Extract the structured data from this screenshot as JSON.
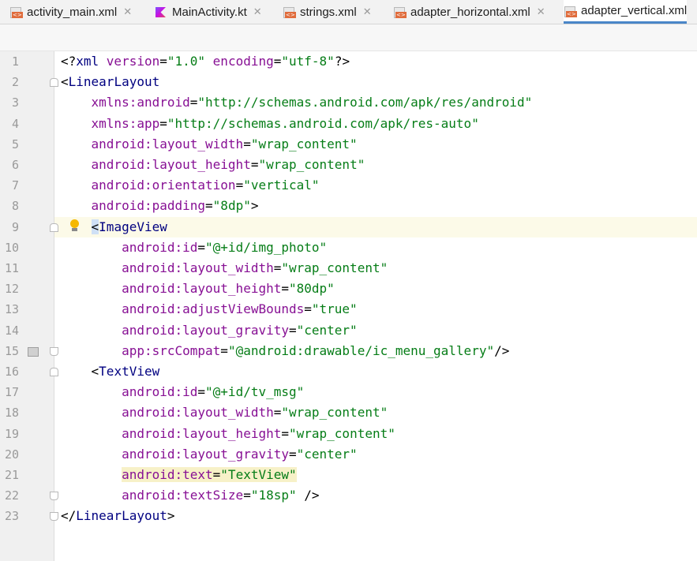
{
  "tabs": [
    {
      "label": "activity_main.xml",
      "icon": "xml-file-icon",
      "close": "✕",
      "active": false
    },
    {
      "label": "MainActivity.kt",
      "icon": "kotlin-file-icon",
      "close": "✕",
      "active": false
    },
    {
      "label": "strings.xml",
      "icon": "xml-file-icon",
      "close": "✕",
      "active": false
    },
    {
      "label": "adapter_horizontal.xml",
      "icon": "xml-file-icon",
      "close": "✕",
      "active": false
    },
    {
      "label": "adapter_vertical.xml",
      "icon": "xml-file-icon",
      "close": "",
      "active": true
    }
  ],
  "editor": {
    "line_numbers": [
      "1",
      "2",
      "3",
      "4",
      "5",
      "6",
      "7",
      "8",
      "9",
      "10",
      "11",
      "12",
      "13",
      "14",
      "15",
      "16",
      "17",
      "18",
      "19",
      "20",
      "21",
      "22",
      "23"
    ],
    "lines": [
      [
        {
          "t": "pun",
          "v": "<?"
        },
        {
          "t": "tag",
          "v": "xml "
        },
        {
          "t": "attr",
          "v": "version"
        },
        {
          "t": "pun",
          "v": "="
        },
        {
          "t": "val",
          "v": "\"1.0\" "
        },
        {
          "t": "attr",
          "v": "encoding"
        },
        {
          "t": "pun",
          "v": "="
        },
        {
          "t": "val",
          "v": "\"utf-8\""
        },
        {
          "t": "pun",
          "v": "?>"
        }
      ],
      [
        {
          "t": "pun",
          "v": "<"
        },
        {
          "t": "tag",
          "v": "LinearLayout"
        }
      ],
      [
        {
          "t": "plain",
          "v": "    "
        },
        {
          "t": "attr",
          "v": "xmlns:android"
        },
        {
          "t": "pun",
          "v": "="
        },
        {
          "t": "val",
          "v": "\"http://schemas.android.com/apk/res/android\""
        }
      ],
      [
        {
          "t": "plain",
          "v": "    "
        },
        {
          "t": "attr",
          "v": "xmlns:app"
        },
        {
          "t": "pun",
          "v": "="
        },
        {
          "t": "val",
          "v": "\"http://schemas.android.com/apk/res-auto\""
        }
      ],
      [
        {
          "t": "plain",
          "v": "    "
        },
        {
          "t": "attr",
          "v": "android:layout_width"
        },
        {
          "t": "pun",
          "v": "="
        },
        {
          "t": "val",
          "v": "\"wrap_content\""
        }
      ],
      [
        {
          "t": "plain",
          "v": "    "
        },
        {
          "t": "attr",
          "v": "android:layout_height"
        },
        {
          "t": "pun",
          "v": "="
        },
        {
          "t": "val",
          "v": "\"wrap_content\""
        }
      ],
      [
        {
          "t": "plain",
          "v": "    "
        },
        {
          "t": "attr",
          "v": "android:orientation"
        },
        {
          "t": "pun",
          "v": "="
        },
        {
          "t": "val",
          "v": "\"vertical\""
        }
      ],
      [
        {
          "t": "plain",
          "v": "    "
        },
        {
          "t": "attr",
          "v": "android:padding"
        },
        {
          "t": "pun",
          "v": "="
        },
        {
          "t": "val",
          "v": "\"8dp\""
        },
        {
          "t": "pun",
          "v": ">"
        }
      ],
      [
        {
          "t": "plain",
          "v": "    "
        },
        {
          "t": "sel",
          "v": "<"
        },
        {
          "t": "tag",
          "v": "ImageView"
        }
      ],
      [
        {
          "t": "plain",
          "v": "        "
        },
        {
          "t": "attr",
          "v": "android:id"
        },
        {
          "t": "pun",
          "v": "="
        },
        {
          "t": "val",
          "v": "\"@+id/img_photo\""
        }
      ],
      [
        {
          "t": "plain",
          "v": "        "
        },
        {
          "t": "attr",
          "v": "android:layout_width"
        },
        {
          "t": "pun",
          "v": "="
        },
        {
          "t": "val",
          "v": "\"wrap_content\""
        }
      ],
      [
        {
          "t": "plain",
          "v": "        "
        },
        {
          "t": "attr",
          "v": "android:layout_height"
        },
        {
          "t": "pun",
          "v": "="
        },
        {
          "t": "val",
          "v": "\"80dp\""
        }
      ],
      [
        {
          "t": "plain",
          "v": "        "
        },
        {
          "t": "attr",
          "v": "android:adjustViewBounds"
        },
        {
          "t": "pun",
          "v": "="
        },
        {
          "t": "val",
          "v": "\"true\""
        }
      ],
      [
        {
          "t": "plain",
          "v": "        "
        },
        {
          "t": "attr",
          "v": "android:layout_gravity"
        },
        {
          "t": "pun",
          "v": "="
        },
        {
          "t": "val",
          "v": "\"center\""
        }
      ],
      [
        {
          "t": "plain",
          "v": "        "
        },
        {
          "t": "attr",
          "v": "app:srcCompat"
        },
        {
          "t": "pun",
          "v": "="
        },
        {
          "t": "val",
          "v": "\"@android:drawable/ic_menu_gallery\""
        },
        {
          "t": "pun",
          "v": "/>"
        }
      ],
      [
        {
          "t": "plain",
          "v": "    "
        },
        {
          "t": "pun",
          "v": "<"
        },
        {
          "t": "tag",
          "v": "TextView"
        }
      ],
      [
        {
          "t": "plain",
          "v": "        "
        },
        {
          "t": "attr",
          "v": "android:id"
        },
        {
          "t": "pun",
          "v": "="
        },
        {
          "t": "val",
          "v": "\"@+id/tv_msg\""
        }
      ],
      [
        {
          "t": "plain",
          "v": "        "
        },
        {
          "t": "attr",
          "v": "android:layout_width"
        },
        {
          "t": "pun",
          "v": "="
        },
        {
          "t": "val",
          "v": "\"wrap_content\""
        }
      ],
      [
        {
          "t": "plain",
          "v": "        "
        },
        {
          "t": "attr",
          "v": "android:layout_height"
        },
        {
          "t": "pun",
          "v": "="
        },
        {
          "t": "val",
          "v": "\"wrap_content\""
        }
      ],
      [
        {
          "t": "plain",
          "v": "        "
        },
        {
          "t": "attr",
          "v": "android:layout_gravity"
        },
        {
          "t": "pun",
          "v": "="
        },
        {
          "t": "val",
          "v": "\"center\""
        }
      ],
      [
        {
          "t": "plain",
          "v": "        "
        },
        {
          "t": "hlattr",
          "v": "android:text"
        },
        {
          "t": "hlpun",
          "v": "="
        },
        {
          "t": "hlval",
          "v": "\"TextView\""
        }
      ],
      [
        {
          "t": "plain",
          "v": "        "
        },
        {
          "t": "attr",
          "v": "android:textSize"
        },
        {
          "t": "pun",
          "v": "="
        },
        {
          "t": "val",
          "v": "\"18sp\""
        },
        {
          "t": "pun",
          "v": " />"
        }
      ],
      [
        {
          "t": "pun",
          "v": "</"
        },
        {
          "t": "tag",
          "v": "LinearLayout"
        },
        {
          "t": "pun",
          "v": ">"
        }
      ]
    ],
    "current_line": "9"
  },
  "colors": {
    "tag": "#000080",
    "attribute": "#871094",
    "value": "#067d17",
    "active_tab_underline": "#4a86c8",
    "current_line_bg": "#fcfae8"
  }
}
